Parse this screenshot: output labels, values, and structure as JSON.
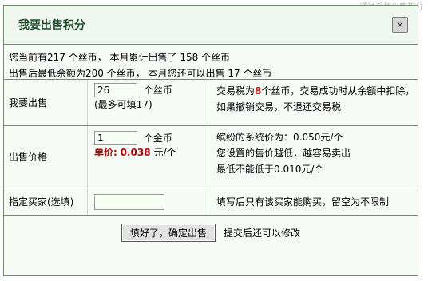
{
  "corner": "通过系统出售积分",
  "dialog": {
    "title": "我要出售积分",
    "close_icon": "×"
  },
  "summary": {
    "line1": "您当前有217 个丝币， 本月累计出售了 158 个丝币",
    "line2": "出售后最低余额为200 个丝币， 本月您还可以出售 17 个丝币"
  },
  "sell": {
    "label": "我要出售",
    "value": "26",
    "unit": "个丝币",
    "hint": "(最多可填17)",
    "info_prefix": "交易税为",
    "tax": "8",
    "info_suffix": "个丝币，交易成功时从余额中扣除，如果撤销交易，不退还交易税"
  },
  "price": {
    "label": "出售价格",
    "value": "1",
    "unit": "个金币",
    "unit_price_label": "单价:",
    "unit_price_value": "0.038",
    "unit_price_suffix": "元/个",
    "info1": "缤纷的系统价为：0.050元/个",
    "info2": "您设置的售价越低，越容易卖出",
    "info3": "最低不能低于0.010元/个"
  },
  "buyer": {
    "label": "指定买家(选填)",
    "value": "",
    "info": "填写后只有该买家能购买，留空为不限制"
  },
  "actions": {
    "submit_label": "填好了，确定出售",
    "note": "提交后还可以修改"
  }
}
